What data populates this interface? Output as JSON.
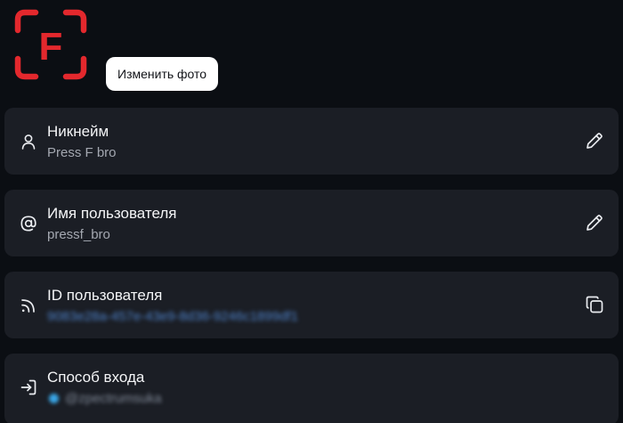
{
  "avatar": {
    "letter": "F",
    "color": "#e3282d"
  },
  "change_photo_label": "Изменить фото",
  "fields": [
    {
      "title": "Никнейм",
      "value": "Press F bro",
      "icon": "user-icon",
      "action": "edit-icon"
    },
    {
      "title": "Имя пользователя",
      "value": "pressf_bro",
      "icon": "at-sign-icon",
      "action": "edit-icon"
    },
    {
      "title": "ID пользователя",
      "value": "9083e28a-457e-43e9-8d36-9246c1899df1",
      "icon": "rss-icon",
      "action": "copy-icon",
      "value_color": "#4f84cc"
    },
    {
      "title": "Способ входа",
      "value": "@zpectrumsuka",
      "icon": "login-icon",
      "badge_color": "#3aa7e8"
    }
  ],
  "colors": {
    "background": "#0b0e13",
    "card": "#1b1e25",
    "text_primary": "#f4f5f7",
    "text_secondary": "#a4a8b1"
  }
}
